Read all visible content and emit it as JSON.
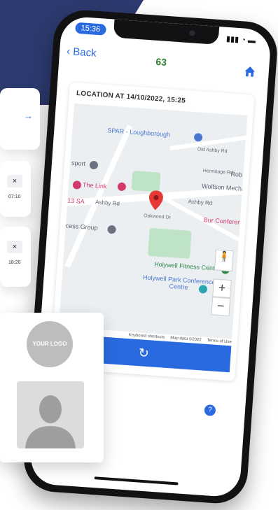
{
  "status_bar": {
    "time": "15:36"
  },
  "header": {
    "back_label": "Back",
    "count": "63"
  },
  "card": {
    "title": "LOCATION AT 14/10/2022, 15:25"
  },
  "map": {
    "labels": {
      "spar": "SPAR - Loughborough",
      "the_link": "The Link",
      "thirteen_sa": "13 SA",
      "ashby_rd": "Ashby Rd",
      "ashby_rd_2": "Ashby Rd",
      "cess_group": "cess Group",
      "holywell_fitness": "Holywell Fitness Centre",
      "holywell_park": "Holywell Park Conference Centre",
      "wolfson": "Wolfson Mechanical",
      "burleigh": "Bur Conference",
      "sport": "sport",
      "hermitage": "Hermitage Rd",
      "old_ashby": "Old Ashby Rd",
      "oakwood": "Oakwood Dr",
      "robs": "Rob"
    },
    "attribution": {
      "shortcuts": "Keyboard shortcuts",
      "map_data": "Map data ©2022",
      "terms": "Terms of Use"
    },
    "zoom_in": "+",
    "zoom_out": "−"
  },
  "refresh_icon": "refresh-icon",
  "overlays": {
    "card2_time": "07:10",
    "card3_time": "18:20",
    "close_glyph": "×",
    "arrow_glyph": "→"
  },
  "logo": {
    "text": "YOUR LOGO"
  },
  "colors": {
    "accent": "#2a6ae0",
    "header_count": "#2e7d32",
    "navy": "#2d3a6f",
    "pin": "#e53935"
  }
}
